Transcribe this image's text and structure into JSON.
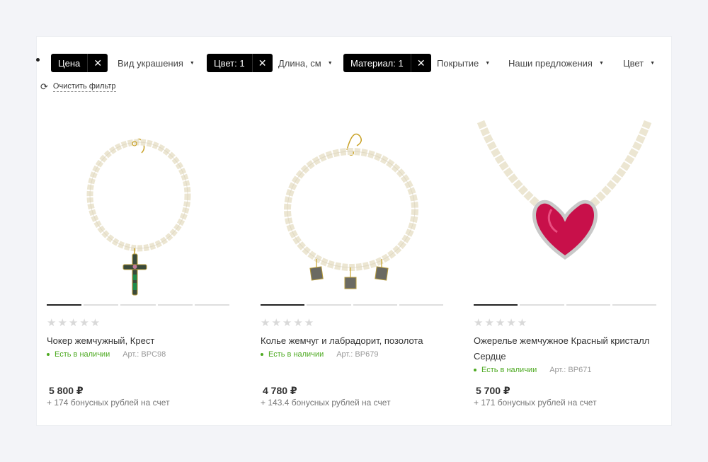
{
  "filters": {
    "price_chip": {
      "label": "Цена",
      "remove": "✕"
    },
    "kind": {
      "label": "Вид украшения",
      "caret": "▼"
    },
    "color_chip": {
      "label": "Цвет: 1",
      "remove": "✕"
    },
    "length": {
      "label": "Длина, см",
      "caret": "▼"
    },
    "material_chip": {
      "label": "Материал: 1",
      "remove": "✕"
    },
    "coating": {
      "label": "Покрытие",
      "caret": "▼"
    },
    "offers": {
      "label": "Наши предложения",
      "caret": "▼"
    },
    "color2": {
      "label": "Цвет",
      "caret": "▼"
    },
    "clear": {
      "icon": "⟳",
      "label": "Очистить фильтр"
    }
  },
  "products": [
    {
      "stars": "★★★★★",
      "name": "Чокер жемчужный, Крест",
      "availability": "Есть в наличии",
      "article": "Арт.: BPC98",
      "price": "5 800 ₽",
      "bonus": "+ 174 бонусных рублей на счет"
    },
    {
      "stars": "★★★★★",
      "name": "Колье жемчуг и лабрадорит, позолота",
      "availability": "Есть в наличии",
      "article": "Арт.: BP679",
      "price": "4 780 ₽",
      "bonus": "+ 143.4 бонусных рублей на счет"
    },
    {
      "stars": "★★★★★",
      "name": "Ожерелье жемчужное Красный кристалл Сердце",
      "availability": "Есть в наличии",
      "article": "Арт.: BP671",
      "price": "5 700 ₽",
      "bonus": "+ 171 бонусных рублей на счет"
    }
  ],
  "colors": {
    "chip": "#000000",
    "in_stock": "#4eaa22",
    "heart": "#c8104a",
    "pearl": "#f4f0e4"
  }
}
